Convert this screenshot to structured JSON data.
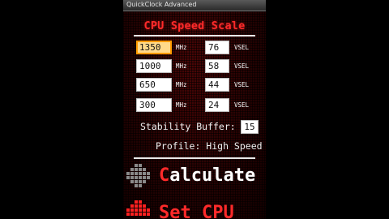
{
  "app": {
    "title": "QuickClock Advanced"
  },
  "heading": "CPU Speed Scale",
  "rows": [
    {
      "mhz": "1350",
      "mhz_unit": "MHz",
      "vsel": "76",
      "vsel_unit": "VSEL",
      "focused": true
    },
    {
      "mhz": "1000",
      "mhz_unit": "MHz",
      "vsel": "58",
      "vsel_unit": "VSEL",
      "focused": false
    },
    {
      "mhz": "650",
      "mhz_unit": "MHz",
      "vsel": "44",
      "vsel_unit": "VSEL",
      "focused": false
    },
    {
      "mhz": "300",
      "mhz_unit": "MHz",
      "vsel": "24",
      "vsel_unit": "VSEL",
      "focused": false
    }
  ],
  "stability": {
    "label": "Stability Buffer:",
    "value": "15"
  },
  "profile": {
    "label": "Profile: High Speed"
  },
  "buttons": {
    "calculate": {
      "first": "C",
      "rest": "alculate"
    },
    "set_cpu": {
      "first": "S",
      "rest": "et CPU"
    }
  },
  "colors": {
    "accent": "#ff2a2a",
    "focus": "#ff9a00",
    "background": "#140000"
  }
}
